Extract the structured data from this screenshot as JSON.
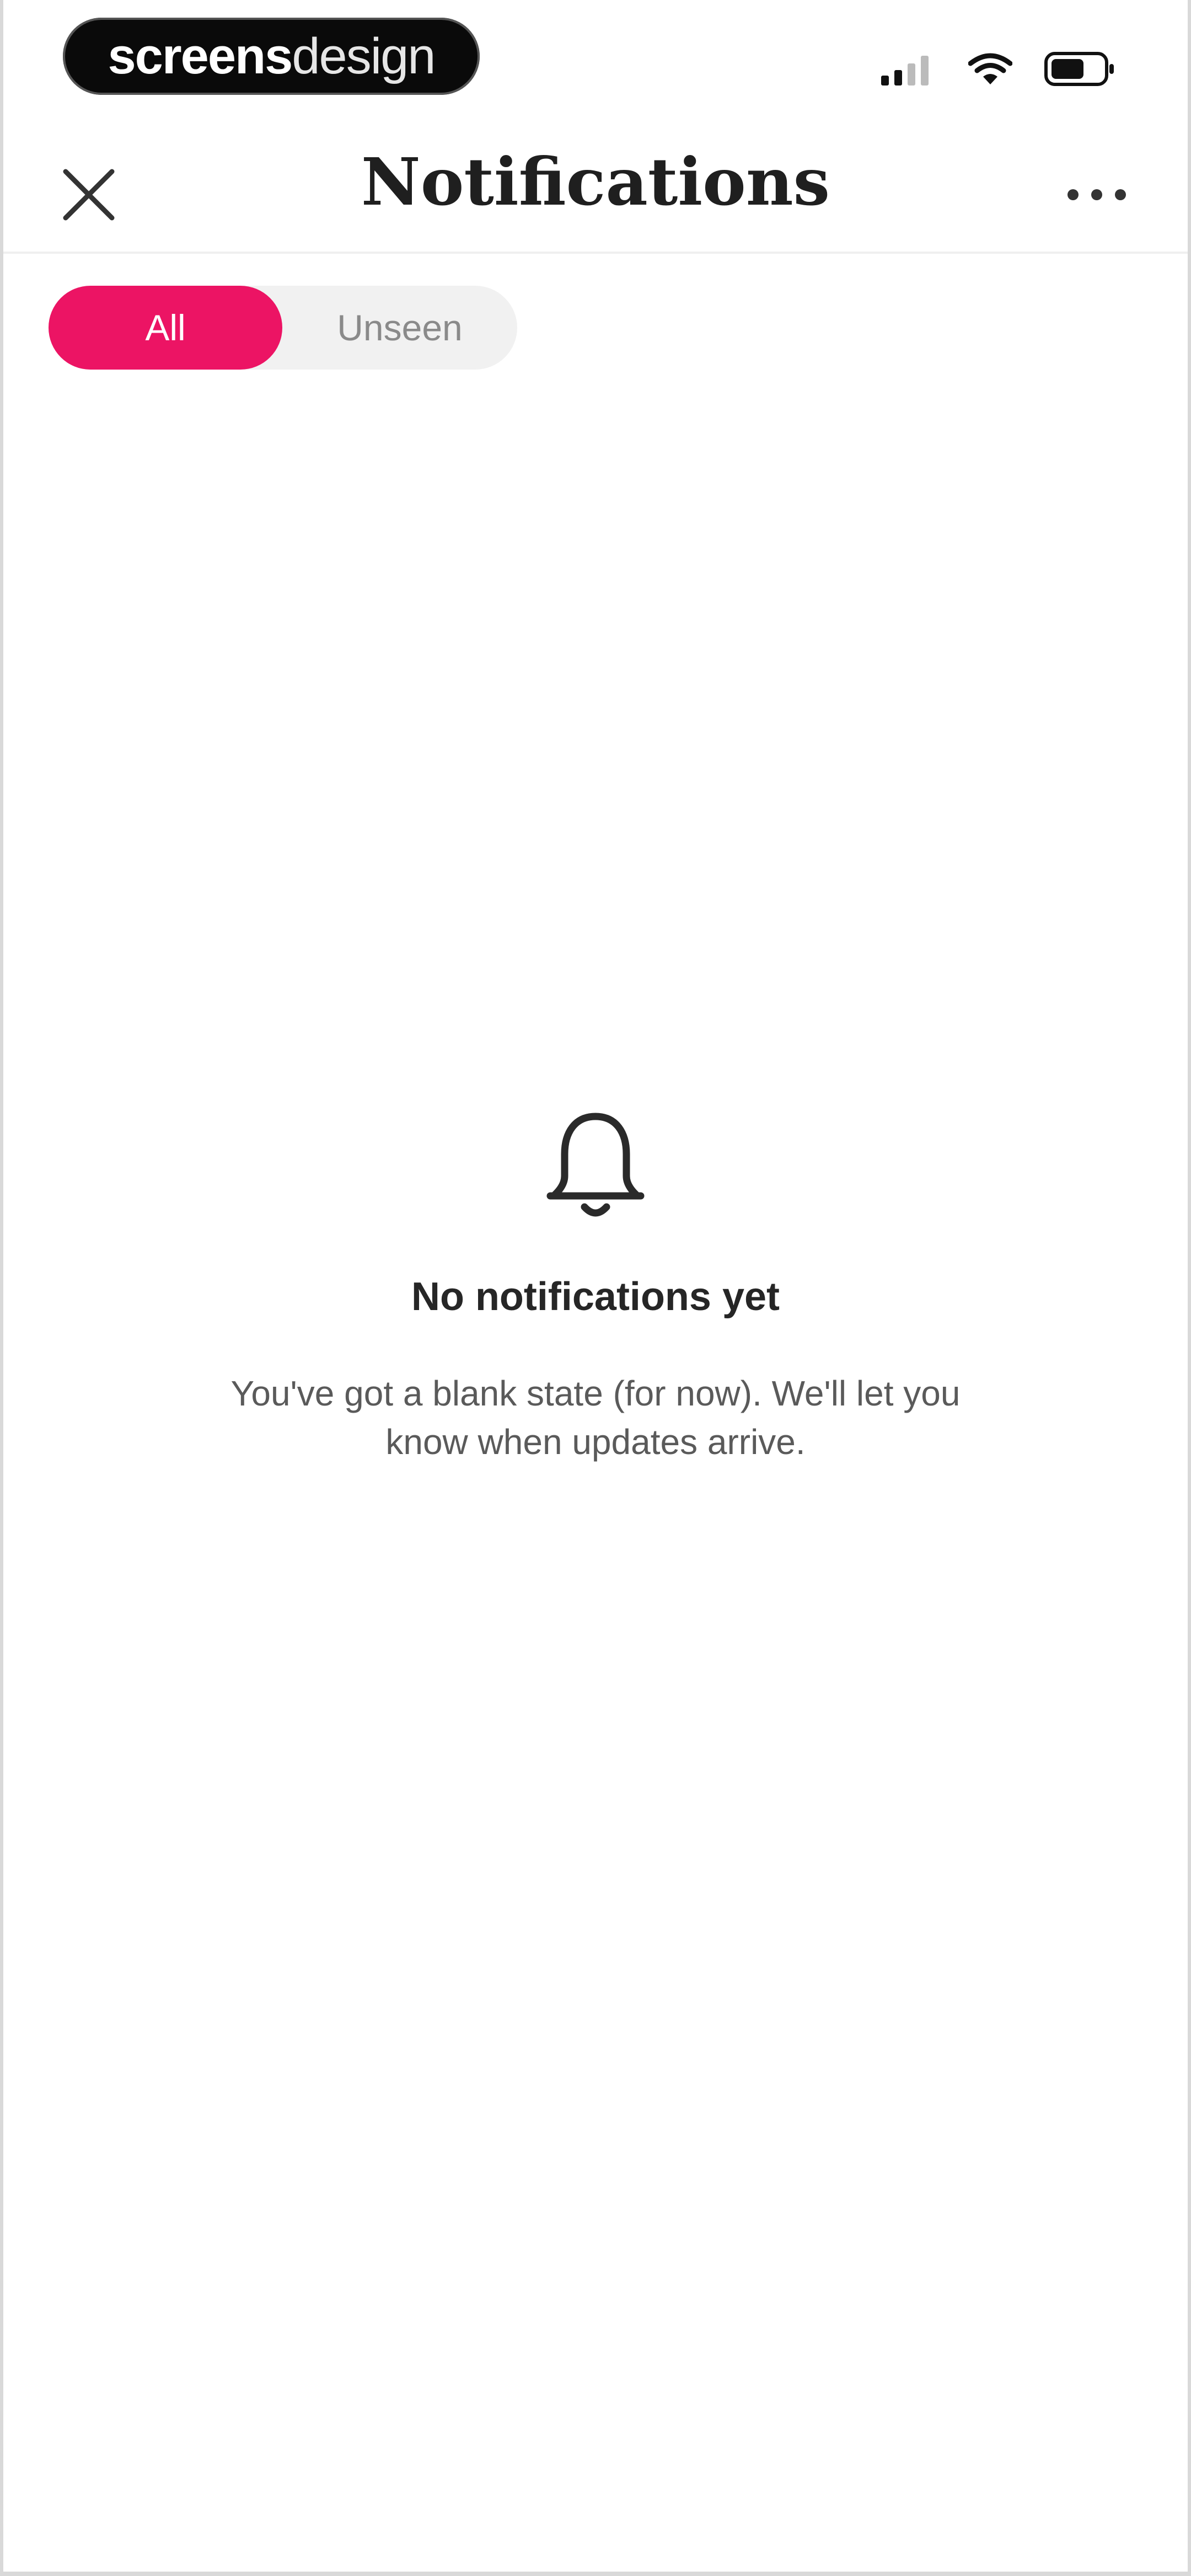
{
  "status_bar": {
    "watermark_bold": "screens",
    "watermark_light": "design",
    "icons": [
      "signal-icon",
      "wifi-icon",
      "battery-icon"
    ]
  },
  "header": {
    "title": "Notifications",
    "close_icon": "close-icon",
    "more_icon": "more-icon"
  },
  "filter": {
    "tabs": [
      {
        "label": "All",
        "selected": true
      },
      {
        "label": "Unseen",
        "selected": false
      }
    ],
    "accent_color": "#ec1464"
  },
  "empty_state": {
    "icon": "bell-icon",
    "title": "No notifications yet",
    "description": "You've got a blank state (for now). We'll let you know when updates arrive."
  }
}
